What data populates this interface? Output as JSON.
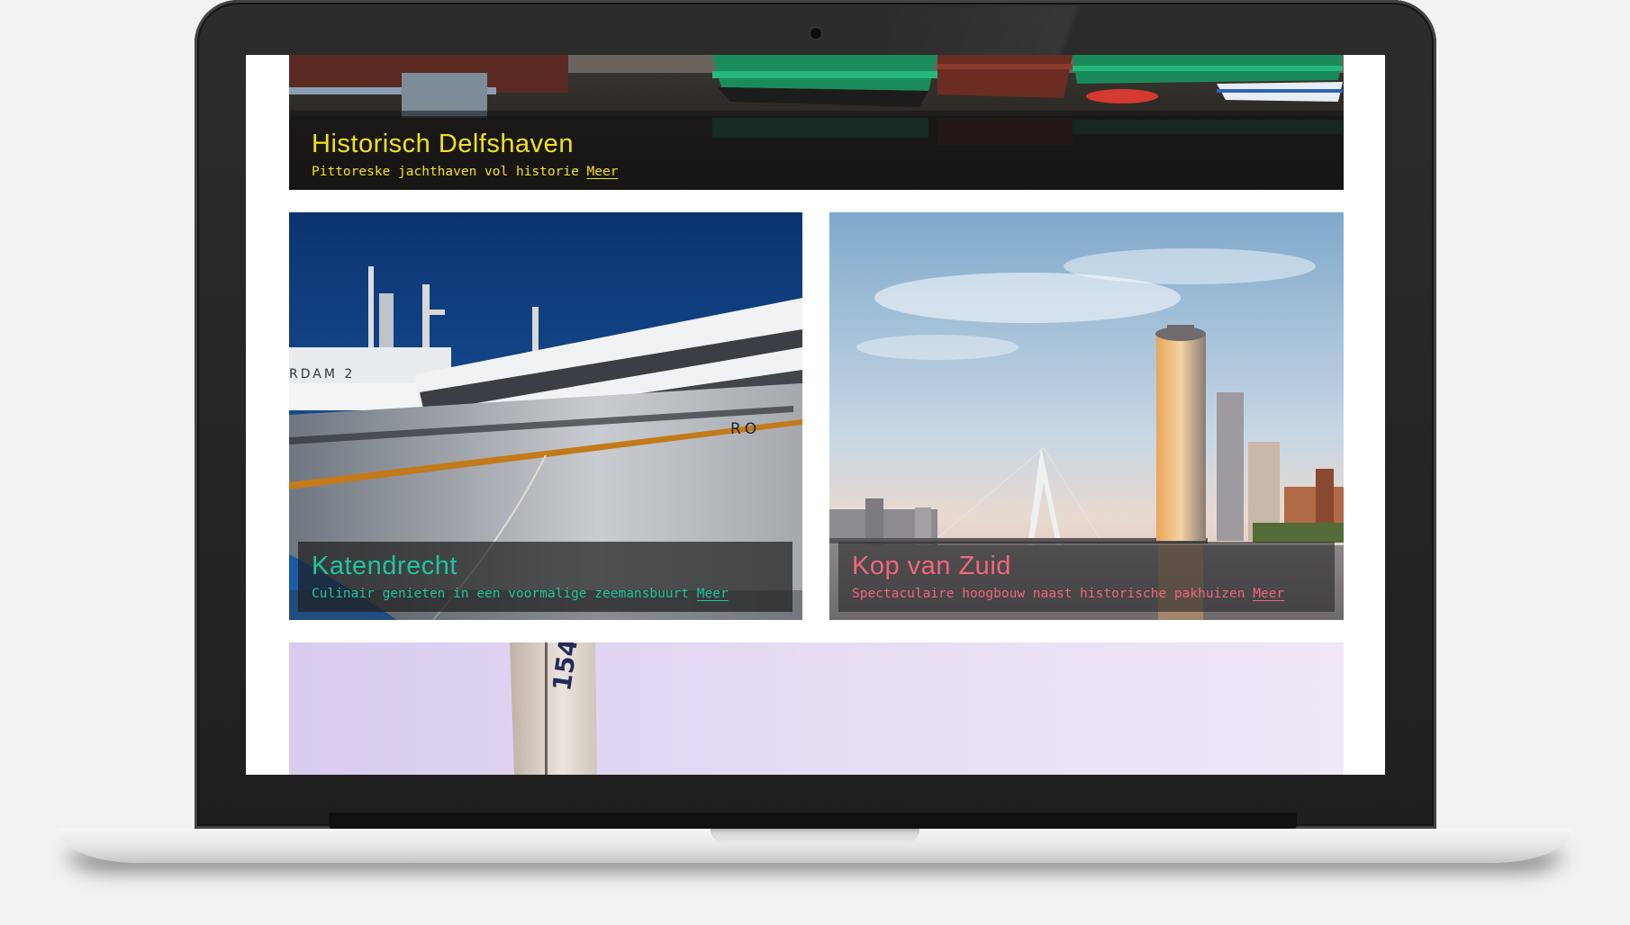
{
  "cards": {
    "delfshaven": {
      "title": "Historisch Delfshaven",
      "subtitle": "Pittoreske jachthaven vol historie",
      "link": "Meer",
      "accent": "#f2e21a"
    },
    "katendrecht": {
      "title": "Katendrecht",
      "subtitle": "Culinair genieten in een voormalige zeemansbuurt",
      "link": "Meer",
      "accent": "#1fc4a2"
    },
    "kopvanzuid": {
      "title": "Kop van Zuid",
      "subtitle": "Spectaculaire hoogbouw naast historische pakhuizen",
      "link": "Meer",
      "accent": "#f2667a"
    },
    "sail": {
      "sail_number": "154"
    }
  },
  "images": {
    "delfshaven": "harbor-boats-photo",
    "katendrecht": "cruise-ship-photo",
    "kopvanzuid": "skyline-bridge-photo",
    "sail": "sailboat-photo"
  },
  "ship_text": {
    "bow": "RO",
    "bridge_sign": "RDAM 2"
  }
}
